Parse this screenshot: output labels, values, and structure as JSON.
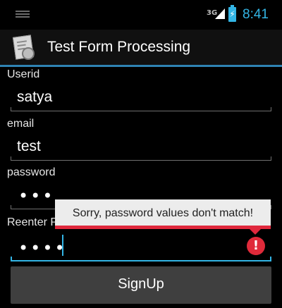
{
  "status_bar": {
    "network_type": "3G",
    "time": "8:41",
    "battery_icon": "battery-charging-icon",
    "accent_color": "#33b5e5"
  },
  "action_bar": {
    "title": "Test Form Processing",
    "icon": "form-app-icon",
    "line_color": "#2f83b3"
  },
  "form": {
    "userid": {
      "label": "Userid",
      "value": "satya"
    },
    "email": {
      "label": "email",
      "value": "test"
    },
    "password": {
      "label": "password",
      "masked_value": "•••"
    },
    "reenter": {
      "label": "Reenter P",
      "masked_value": "••••"
    }
  },
  "error": {
    "message": "Sorry, password values don't match!",
    "icon": "error-icon",
    "color": "#e0283d"
  },
  "signup_button": {
    "label": "SignUp"
  }
}
